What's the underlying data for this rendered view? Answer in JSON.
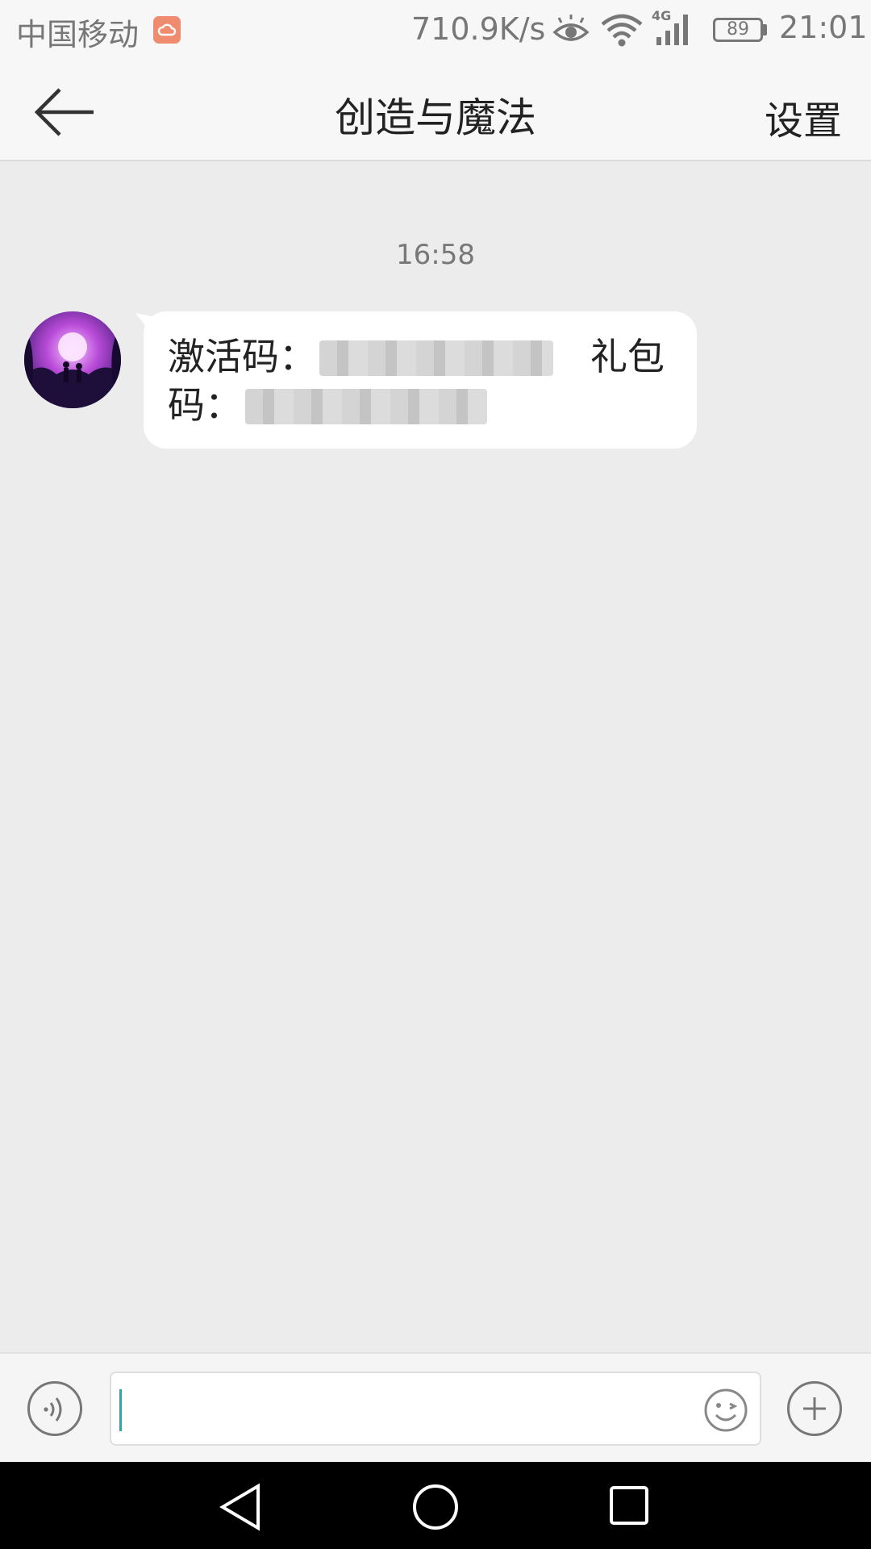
{
  "status_bar": {
    "carrier": "中国移动",
    "speed": "710.9K/s",
    "network_label": "4G",
    "battery": "89",
    "time": "21:01"
  },
  "header": {
    "title": "创造与魔法",
    "settings_label": "设置"
  },
  "chat": {
    "timestamp": "16:58",
    "message": {
      "activation_label": "激活码：",
      "gift_label_part1": "礼包",
      "gift_label_part2": "码："
    }
  },
  "colors": {
    "cloud_badge": "#ef8c6f",
    "caret": "#33a4ad",
    "background": "#ececec"
  },
  "icons": {
    "back": "back-arrow-icon",
    "voice": "voice-icon",
    "emoji": "emoji-icon",
    "plus": "plus-icon",
    "nav_back": "triangle-back-icon",
    "nav_home": "circle-home-icon",
    "nav_recent": "square-recent-icon"
  }
}
